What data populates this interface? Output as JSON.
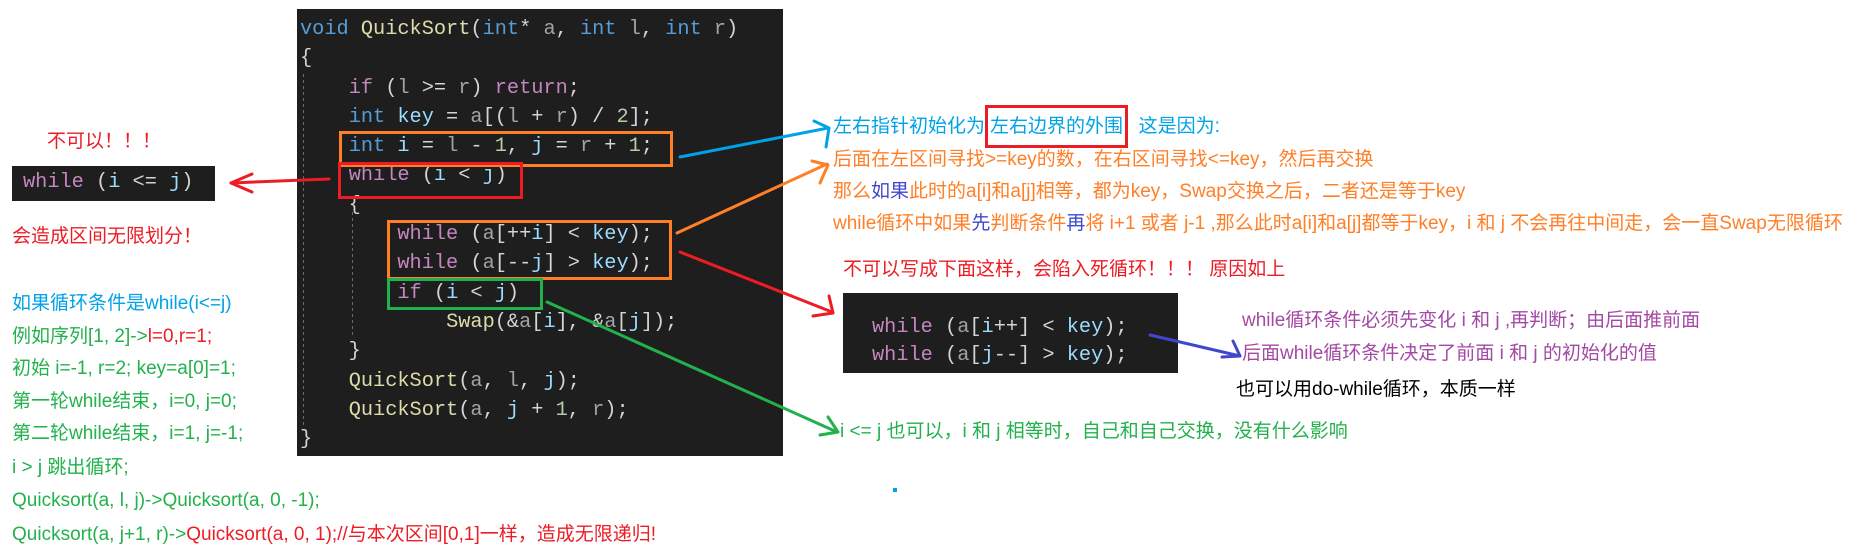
{
  "palette": {
    "red": "#ED1C24",
    "orange": "#FF7F27",
    "green": "#22B14C",
    "blue": "#00A2E8",
    "indigo": "#3F48CC",
    "purple": "#A349A4",
    "black": "#000000"
  },
  "editor_background": "#1E1E1E",
  "syntax_colors": {
    "kw": "#569CD6",
    "ctrl": "#C586C0",
    "fn": "#DCDCAA",
    "var": "#9CDCFE",
    "param": "#A0A4A8",
    "num": "#B5CEA8",
    "p": "#D4D4D4"
  },
  "main_code": {
    "lines": [
      [
        [
          "kw",
          "void"
        ],
        [
          "p",
          " "
        ],
        [
          "fn",
          "QuickSort"
        ],
        [
          "p",
          "("
        ],
        [
          "kw",
          "int"
        ],
        [
          "p",
          "* "
        ],
        [
          "param",
          "a"
        ],
        [
          "p",
          ", "
        ],
        [
          "kw",
          "int"
        ],
        [
          "p",
          " "
        ],
        [
          "param",
          "l"
        ],
        [
          "p",
          ", "
        ],
        [
          "kw",
          "int"
        ],
        [
          "p",
          " "
        ],
        [
          "param",
          "r"
        ],
        [
          "p",
          ")"
        ]
      ],
      [
        [
          "p",
          "{"
        ]
      ],
      [
        [
          "p",
          "    "
        ],
        [
          "ctrl",
          "if"
        ],
        [
          "p",
          " ("
        ],
        [
          "param",
          "l"
        ],
        [
          "p",
          " >= "
        ],
        [
          "param",
          "r"
        ],
        [
          "p",
          ") "
        ],
        [
          "ctrl",
          "return"
        ],
        [
          "p",
          ";"
        ]
      ],
      [
        [
          "p",
          "    "
        ],
        [
          "kw",
          "int"
        ],
        [
          "p",
          " "
        ],
        [
          "var",
          "key"
        ],
        [
          "p",
          " = "
        ],
        [
          "param",
          "a"
        ],
        [
          "p",
          "[("
        ],
        [
          "param",
          "l"
        ],
        [
          "p",
          " + "
        ],
        [
          "param",
          "r"
        ],
        [
          "p",
          ") / "
        ],
        [
          "num",
          "2"
        ],
        [
          "p",
          "];"
        ]
      ],
      [
        [
          "p",
          "    "
        ],
        [
          "kw",
          "int"
        ],
        [
          "p",
          " "
        ],
        [
          "var",
          "i"
        ],
        [
          "p",
          " = "
        ],
        [
          "param",
          "l"
        ],
        [
          "p",
          " - "
        ],
        [
          "num",
          "1"
        ],
        [
          "p",
          ", "
        ],
        [
          "var",
          "j"
        ],
        [
          "p",
          " = "
        ],
        [
          "param",
          "r"
        ],
        [
          "p",
          " + "
        ],
        [
          "num",
          "1"
        ],
        [
          "p",
          ";"
        ]
      ],
      [
        [
          "p",
          "    "
        ],
        [
          "ctrl",
          "while"
        ],
        [
          "p",
          " ("
        ],
        [
          "var",
          "i"
        ],
        [
          "p",
          " < "
        ],
        [
          "var",
          "j"
        ],
        [
          "p",
          ")"
        ]
      ],
      [
        [
          "p",
          "    {"
        ]
      ],
      [
        [
          "p",
          "        "
        ],
        [
          "ctrl",
          "while"
        ],
        [
          "p",
          " ("
        ],
        [
          "param",
          "a"
        ],
        [
          "p",
          "[++"
        ],
        [
          "var",
          "i"
        ],
        [
          "p",
          "] < "
        ],
        [
          "var",
          "key"
        ],
        [
          "p",
          ");"
        ]
      ],
      [
        [
          "p",
          "        "
        ],
        [
          "ctrl",
          "while"
        ],
        [
          "p",
          " ("
        ],
        [
          "param",
          "a"
        ],
        [
          "p",
          "[--"
        ],
        [
          "var",
          "j"
        ],
        [
          "p",
          "] > "
        ],
        [
          "var",
          "key"
        ],
        [
          "p",
          ");"
        ]
      ],
      [
        [
          "p",
          "        "
        ],
        [
          "ctrl",
          "if"
        ],
        [
          "p",
          " ("
        ],
        [
          "var",
          "i"
        ],
        [
          "p",
          " < "
        ],
        [
          "var",
          "j"
        ],
        [
          "p",
          ")"
        ]
      ],
      [
        [
          "p",
          "            "
        ],
        [
          "fn",
          "Swap"
        ],
        [
          "p",
          "(&"
        ],
        [
          "param",
          "a"
        ],
        [
          "p",
          "["
        ],
        [
          "var",
          "i"
        ],
        [
          "p",
          "], &"
        ],
        [
          "param",
          "a"
        ],
        [
          "p",
          "["
        ],
        [
          "var",
          "j"
        ],
        [
          "p",
          "]);"
        ]
      ],
      [
        [
          "p",
          "    }"
        ]
      ],
      [
        [
          "p",
          "    "
        ],
        [
          "fn",
          "QuickSort"
        ],
        [
          "p",
          "("
        ],
        [
          "param",
          "a"
        ],
        [
          "p",
          ", "
        ],
        [
          "param",
          "l"
        ],
        [
          "p",
          ", "
        ],
        [
          "var",
          "j"
        ],
        [
          "p",
          ");"
        ]
      ],
      [
        [
          "p",
          "    "
        ],
        [
          "fn",
          "QuickSort"
        ],
        [
          "p",
          "("
        ],
        [
          "param",
          "a"
        ],
        [
          "p",
          ", "
        ],
        [
          "var",
          "j"
        ],
        [
          "p",
          " + "
        ],
        [
          "num",
          "1"
        ],
        [
          "p",
          ", "
        ],
        [
          "param",
          "r"
        ],
        [
          "p",
          ");"
        ]
      ],
      [
        [
          "p",
          "}"
        ]
      ]
    ]
  },
  "left_snippet": {
    "lines": [
      [
        [
          "ctrl",
          "while"
        ],
        [
          "p",
          " ("
        ],
        [
          "var",
          "i"
        ],
        [
          "p",
          " <= "
        ],
        [
          "var",
          "j"
        ],
        [
          "p",
          ")"
        ]
      ]
    ]
  },
  "right_snippet": {
    "lines": [
      [
        [
          "ctrl",
          "while"
        ],
        [
          "p",
          " ("
        ],
        [
          "param",
          "a"
        ],
        [
          "p",
          "["
        ],
        [
          "var",
          "i"
        ],
        [
          "p",
          "++] < "
        ],
        [
          "var",
          "key"
        ],
        [
          "p",
          ");"
        ]
      ],
      [
        [
          "ctrl",
          "while"
        ],
        [
          "p",
          " ("
        ],
        [
          "param",
          "a"
        ],
        [
          "p",
          "["
        ],
        [
          "var",
          "j"
        ],
        [
          "p",
          "--] > "
        ],
        [
          "var",
          "key"
        ],
        [
          "p",
          ");"
        ]
      ]
    ]
  },
  "left_notes": [
    {
      "segments": [
        {
          "text": "不可以！！！",
          "color": "red"
        }
      ]
    },
    {
      "segments": [
        {
          "text": "会造成区间无限划分！",
          "color": "red"
        }
      ]
    },
    {
      "segments": [
        {
          "text": "如果循环条件是while(i<=j)",
          "color": "blue"
        }
      ]
    },
    {
      "segments": [
        {
          "text": "例如序列[1, 2]->",
          "color": "green"
        },
        {
          "text": "l=0,r=1;",
          "color": "red"
        }
      ]
    },
    {
      "segments": [
        {
          "text": "初始 i=-1, r=2; key=a[0]=1;",
          "color": "green"
        }
      ]
    },
    {
      "segments": [
        {
          "text": "第一轮while结束，i=0, j=0;",
          "color": "green"
        }
      ]
    },
    {
      "segments": [
        {
          "text": "第二轮while结束，i=1, j=-1;",
          "color": "green"
        }
      ]
    },
    {
      "segments": [
        {
          "text": "i > j 跳出循环;",
          "color": "green"
        }
      ]
    },
    {
      "segments": [
        {
          "text": "Quicksort(a, l, j)->Quicksort(a, 0, -1);",
          "color": "green"
        }
      ]
    },
    {
      "segments": [
        {
          "text": "Quicksort(a, j+1, r)->",
          "color": "green"
        },
        {
          "text": "Quicksort(a, 0, 1);//与本次区间[0,1]一样，造成无限递归!",
          "color": "red"
        }
      ]
    }
  ],
  "right_notes": [
    {
      "segments": [
        {
          "text": "左右指针初始化为",
          "color": "blue"
        },
        {
          "text": "左右边界的外围",
          "color": "blue",
          "highlight_box": "red"
        },
        {
          "text": "  这是因为:",
          "color": "blue"
        }
      ]
    },
    {
      "segments": [
        {
          "text": "后面在左区间寻找>=key的数，在右区间寻找<=key，然后再交换",
          "color": "orange"
        }
      ]
    },
    {
      "segments": [
        {
          "text": "那么",
          "color": "orange"
        },
        {
          "text": "如果",
          "color": "indigo"
        },
        {
          "text": "此时的a[i]和a[j]相等，都为key，Swap交换之后，二者还是等于key",
          "color": "orange"
        }
      ]
    },
    {
      "segments": [
        {
          "text": "while循环中如果",
          "color": "orange"
        },
        {
          "text": "先",
          "color": "indigo"
        },
        {
          "text": "判断条件",
          "color": "orange"
        },
        {
          "text": "再",
          "color": "indigo"
        },
        {
          "text": "将 i+1 或者 j-1 ,那么此时a[i]和a[j]都等于key，i 和 j 不会再往中间走，会一直Swap无限循环",
          "color": "orange"
        }
      ]
    },
    {
      "segments": [
        {
          "text": "不可以写成下面这样，会陷入死循环！！！ 原因如上",
          "color": "red"
        }
      ]
    },
    {
      "segments": [
        {
          "text": "while循环条件必须先变化 i 和 j ,再判断；由后面推前面",
          "color": "purple"
        }
      ]
    },
    {
      "segments": [
        {
          "text": "后面while循环条件决定了前面 i 和 j 的初始化的值",
          "color": "purple"
        }
      ]
    },
    {
      "segments": [
        {
          "text": "也可以用do-while循环，本质一样",
          "color": "black"
        }
      ]
    },
    {
      "segments": [
        {
          "text": "i <= j 也可以，i 和 j 相等时，自己和自己交换，没有什么影响",
          "color": "green"
        }
      ]
    }
  ]
}
